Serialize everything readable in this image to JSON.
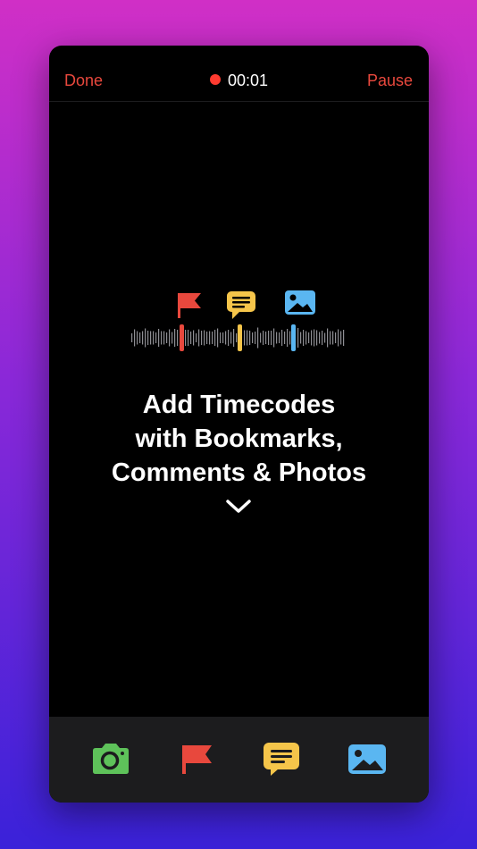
{
  "header": {
    "done_label": "Done",
    "pause_label": "Pause",
    "timer": "00:01"
  },
  "onboarding": {
    "line1": "Add Timecodes",
    "line2": "with Bookmarks,",
    "line3": "Comments & Photos"
  },
  "toolbar": {
    "items": [
      {
        "icon": "camera-icon",
        "color": "#5ec25a"
      },
      {
        "icon": "flag-icon",
        "color": "#e8483d"
      },
      {
        "icon": "comment-icon",
        "color": "#f5c54a"
      },
      {
        "icon": "photo-icon",
        "color": "#5ab6f1"
      }
    ]
  },
  "colors": {
    "accent": "#e8483d",
    "record": "#ff3b30",
    "bookmark": "#e8483d",
    "comment": "#f5c54a",
    "photo": "#5ab6f1"
  }
}
